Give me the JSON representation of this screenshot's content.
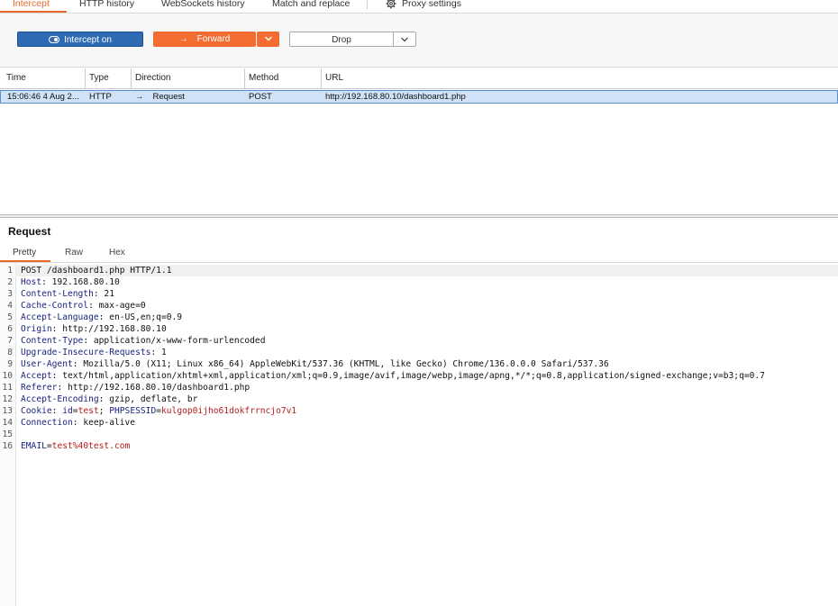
{
  "tabs": [
    {
      "label": "Intercept",
      "active": true
    },
    {
      "label": "HTTP history"
    },
    {
      "label": "WebSockets history"
    },
    {
      "label": "Match and replace"
    },
    {
      "label": "Proxy settings",
      "icon": "gear-icon"
    }
  ],
  "toolbar": {
    "intercept_label": "Intercept on",
    "forward_label": "Forward",
    "drop_label": "Drop",
    "forward_icon": "arrow-right-icon",
    "dropdown_icon": "chevron-down-icon"
  },
  "table": {
    "columns": [
      "Time",
      "Type",
      "Direction",
      "Method",
      "URL"
    ],
    "rows": [
      {
        "time": "15:06:46 4 Aug 2...",
        "type": "HTTP",
        "direction": "Request",
        "direction_icon": "arrow-right-icon",
        "method": "POST",
        "url": "http://192.168.80.10/dashboard1.php"
      }
    ]
  },
  "request": {
    "title": "Request",
    "tabs": [
      "Pretty",
      "Raw",
      "Hex"
    ],
    "active_tab": "Pretty",
    "lines": [
      {
        "n": "1",
        "key": "",
        "val": "POST /dashboard1.php HTTP/1.1"
      },
      {
        "n": "2",
        "key": "Host",
        "val": ": 192.168.80.10"
      },
      {
        "n": "3",
        "key": "Content-Length",
        "val": ": 21"
      },
      {
        "n": "4",
        "key": "Cache-Control",
        "val": ": max-age=0"
      },
      {
        "n": "5",
        "key": "Accept-Language",
        "val": ": en-US,en;q=0.9"
      },
      {
        "n": "6",
        "key": "Origin",
        "val": ": http://192.168.80.10"
      },
      {
        "n": "7",
        "key": "Content-Type",
        "val": ": application/x-www-form-urlencoded"
      },
      {
        "n": "8",
        "key": "Upgrade-Insecure-Requests",
        "val": ": 1"
      },
      {
        "n": "9",
        "key": "User-Agent",
        "val": ": Mozilla/5.0 (X11; Linux x86_64) AppleWebKit/537.36 (KHTML, like Gecko) Chrome/136.0.0.0 Safari/537.36"
      },
      {
        "n": "10",
        "key": "Accept",
        "val": ": text/html,application/xhtml+xml,application/xml;q=0.9,image/avif,image/webp,image/apng,*/*;q=0.8,application/signed-exchange;v=b3;q=0.7"
      },
      {
        "n": "11",
        "key": "Referer",
        "val": ": http://192.168.80.10/dashboard1.php"
      },
      {
        "n": "12",
        "key": "Accept-Encoding",
        "val": ": gzip, deflate, br"
      },
      {
        "n": "13",
        "key": "Cookie",
        "val": ": ",
        "cookie": [
          {
            "k": "id",
            "v": "test",
            "sep": "; "
          },
          {
            "k": "PHPSESSID",
            "v": "kulgop0ijho61dokfrrncjo7v1",
            "sep": ""
          }
        ]
      },
      {
        "n": "14",
        "key": "Connection",
        "val": ": keep-alive"
      },
      {
        "n": "15",
        "key": "",
        "val": ""
      },
      {
        "n": "16",
        "key": "",
        "val": "",
        "body": {
          "k": "EMAIL",
          "v": "test%40test.com"
        }
      }
    ]
  }
}
